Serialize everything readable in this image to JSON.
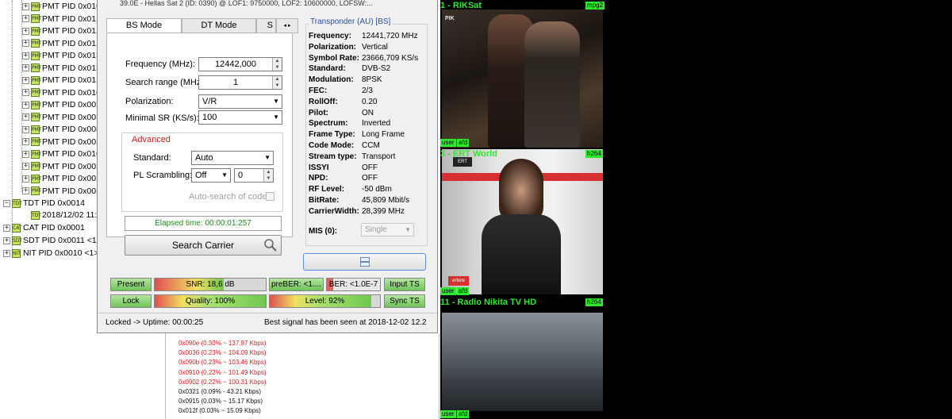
{
  "tree": {
    "pmt_items": [
      "PMT PID 0x010",
      "PMT PID 0x012",
      "PMT PID 0x012",
      "PMT PID 0x012",
      "PMT PID 0x013",
      "PMT PID 0x013",
      "PMT PID 0x013",
      "PMT PID 0x010",
      "PMT PID 0x002",
      "PMT PID 0x003",
      "PMT PID 0x008",
      "PMT PID 0x002",
      "PMT PID 0x010",
      "PMT PID 0x002",
      "PMT PID 0x002",
      "PMT PID 0x003"
    ],
    "tdt": "TDT PID 0x0014",
    "tdt_child": "2018/12/02 11:2",
    "cat": "CAT PID 0x0001",
    "sdt": "SDT PID 0x0011 <1",
    "nit": "NIT PID 0x0010 <1>"
  },
  "pid_list": [
    {
      "text": "0x090e (0.30% ~ 137.97 Kbps)",
      "color": "#d42020"
    },
    {
      "text": "0x0036 (0.23% ~ 104.09 Kbps)",
      "color": "#d42020"
    },
    {
      "text": "0x090b (0.23% ~ 103.46 Kbps)",
      "color": "#d42020"
    },
    {
      "text": "0x0910 (0.22% ~ 101.49 Kbps)",
      "color": "#d42020"
    },
    {
      "text": "0x0902 (0.22% ~ 100.31 Kbps)",
      "color": "#d42020"
    },
    {
      "text": "0x0321 (0.09% - 43.21 Kbps)",
      "color": "#111111"
    },
    {
      "text": "0x0915 (0.03% ~ 15.17 Kbps)",
      "color": "#111111"
    },
    {
      "text": "0x012f (0.03% ~ 15.09 Kbps)",
      "color": "#111111"
    }
  ],
  "dialog": {
    "title": "39.0E - Hellas Sat 2 (ID: 0390) @ LOF1: 9750000, LOF2: 10600000, LOFSW:...",
    "tabs": [
      "BS Mode",
      "DT Mode",
      "S"
    ],
    "frequency_label": "Frequency (MHz):",
    "frequency_value": "12442,000",
    "search_range_label": "Search range (MHz):",
    "search_range_value": "1",
    "polarization_label": "Polarization:",
    "polarization_value": "V/R",
    "minimal_sr_label": "Minimal SR (KS/s):",
    "minimal_sr_value": "100",
    "advanced_label": "Advanced",
    "standard_label": "Standard:",
    "standard_value": "Auto",
    "pl_label": "PL Scrambling:",
    "pl_value": "Off",
    "pl_number": "0",
    "autosearch_label": "Auto-search of code",
    "elapsed": "Elapsed time: 00:00:01:257",
    "search_button": "Search Carrier",
    "transponder_title": "Transponder (AU) [BS]",
    "transponder": [
      {
        "k": "Frequency:",
        "v": "12441,720 MHz"
      },
      {
        "k": "Polarization:",
        "v": "Vertical"
      },
      {
        "k": "Symbol Rate:",
        "v": "23666,709 KS/s"
      },
      {
        "k": "Standard:",
        "v": "DVB-S2"
      },
      {
        "k": "Modulation:",
        "v": "8PSK"
      },
      {
        "k": "FEC:",
        "v": "2/3"
      },
      {
        "k": "RollOff:",
        "v": "0.20"
      },
      {
        "k": "Pilot:",
        "v": "ON"
      },
      {
        "k": "Spectrum:",
        "v": "Inverted"
      },
      {
        "k": "Frame Type:",
        "v": "Long Frame"
      },
      {
        "k": "Code Mode:",
        "v": "CCM"
      },
      {
        "k": "Stream type:",
        "v": "Transport"
      },
      {
        "k": "ISSYI",
        "v": "OFF"
      },
      {
        "k": "NPD:",
        "v": "OFF"
      },
      {
        "k": "RF Level:",
        "v": "-50 dBm"
      },
      {
        "k": "BitRate:",
        "v": "45,809 Mbit/s"
      },
      {
        "k": "CarrierWidth:",
        "v": "28,399 MHz"
      }
    ],
    "mis_label": "MIS (0):",
    "mis_value": "Single",
    "present": "Present",
    "lock": "Lock",
    "snr": "SNR: 18,6 dB",
    "snr_fraction": 0.62,
    "quality": "Quality: 100%",
    "quality_fraction": 1.0,
    "preber": "preBER: <1....",
    "ber": "BER: <1.0E-7",
    "level": "Level: 92%",
    "level_fraction": 0.92,
    "input_ts": "Input TS",
    "sync_ts": "Sync TS",
    "status_left": "Locked -> Uptime: 00:00:25",
    "status_right": "Best signal has been seen at 2018-12-02 12.2"
  },
  "video": [
    {
      "label": "1 - RIKSat",
      "codec": "mpg2",
      "tags": [
        "user",
        "afd"
      ]
    },
    {
      "label": "3 - ERT World",
      "codec": "h264",
      "tags": [
        "user",
        "afd"
      ]
    },
    {
      "label": "11 - Radio Nikita  TV HD",
      "codec": "h264",
      "tags": [
        "user",
        "afd"
      ]
    }
  ],
  "colors": {
    "green": "#2ee82e",
    "accent": "#2a4fa8"
  }
}
